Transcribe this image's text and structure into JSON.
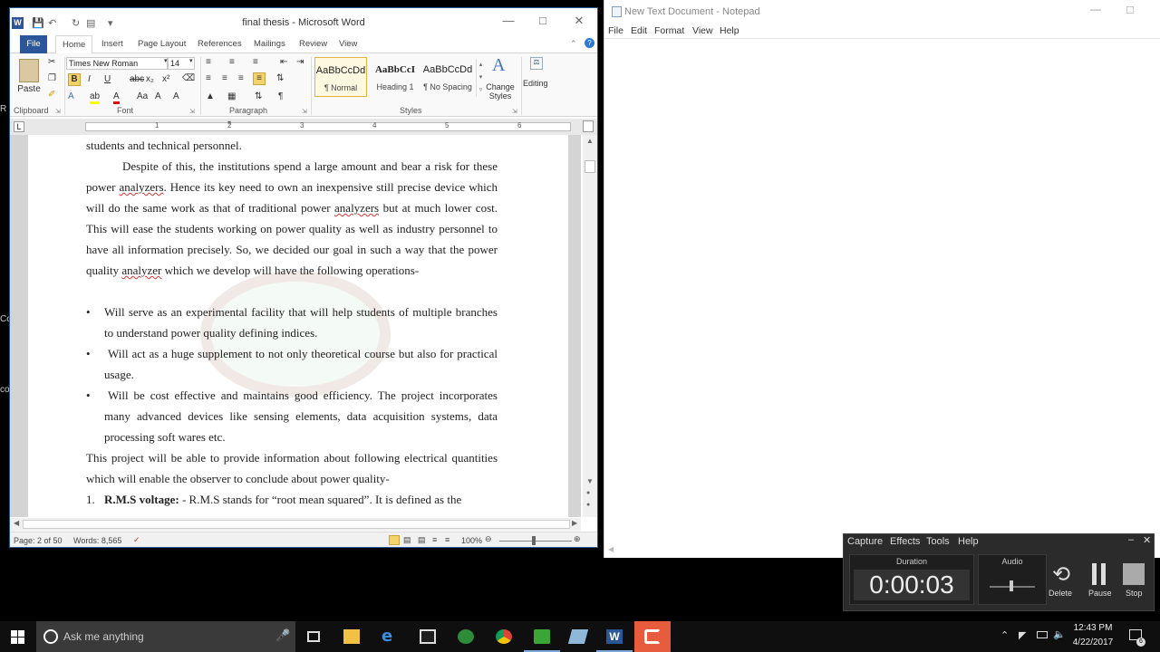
{
  "word": {
    "title": "final thesis - Microsoft Word",
    "logo": "W",
    "tabs": [
      "File",
      "Home",
      "Insert",
      "Page Layout",
      "References",
      "Mailings",
      "Review",
      "View"
    ],
    "clipboard": {
      "paste": "Paste",
      "group": "Clipboard"
    },
    "font": {
      "name": "Times New Roman",
      "size": "14",
      "group": "Font"
    },
    "paragraph_group": "Paragraph",
    "styles": [
      {
        "preview": "AaBbCcDd",
        "name": "¶ Normal"
      },
      {
        "preview": "AaBbCcI",
        "name": "Heading 1"
      },
      {
        "preview": "AaBbCcDd",
        "name": "¶ No Spacing"
      }
    ],
    "change_styles": "Change Styles",
    "styles_group": "Styles",
    "editing": "Editing",
    "ruler_ticks": [
      "1",
      "2",
      "3",
      "4",
      "5",
      "6"
    ],
    "doc": {
      "line0": "students and technical personnel.",
      "p1a": "Despite of this, the institutions spend a large amount and bear a risk for these power ",
      "p1b": "analyzers",
      "p1c": ". Hence its key need to own an inexpensive still precise device which will do the same work as that of traditional power ",
      "p1d": "analyzers",
      "p1e": " but at much lower cost. This will ease the students working on power quality as well as industry personnel to have all information precisely.  So, we decided our goal in such a way that the power quality ",
      "p1f": "analyzer",
      "p1g": " which we develop will have the following operations-",
      "bullet": "•",
      "b1": "Will serve as an experimental facility that will help students of multiple branches to understand power quality defining indices.",
      "b2": "Will act as a huge supplement to not only theoretical course but also for practical usage.",
      "b3": "Will be cost effective and maintains good efficiency. The project incorporates many advanced devices like sensing elements, data acquisition systems, data processing soft wares etc.",
      "p2": "This project will be able to provide information about following electrical quantities which will enable the observer to conclude about power quality-",
      "n1num": "1.",
      "n1bold": "R.M.S voltage:",
      "n1rest": " - R.M.S stands for “root mean squared”. It is defined as the"
    },
    "status": {
      "page": "Page: 2 of 50",
      "words": "Words: 8,565",
      "zoom": "100%"
    }
  },
  "notepad": {
    "title": "New Text Document - Notepad",
    "menu": [
      "File",
      "Edit",
      "Format",
      "View",
      "Help"
    ]
  },
  "recorder": {
    "menu": [
      "Capture",
      "Effects",
      "Tools",
      "Help"
    ],
    "duration_label": "Duration",
    "duration": "0:00:03",
    "audio_label": "Audio",
    "delete": "Delete",
    "pause": "Pause",
    "stop": "Stop"
  },
  "left_edge": [
    "R",
    "Co",
    "co"
  ],
  "taskbar": {
    "search": "Ask me anything",
    "time": "12:43 PM",
    "date": "4/22/2017",
    "notif_count": "6"
  }
}
